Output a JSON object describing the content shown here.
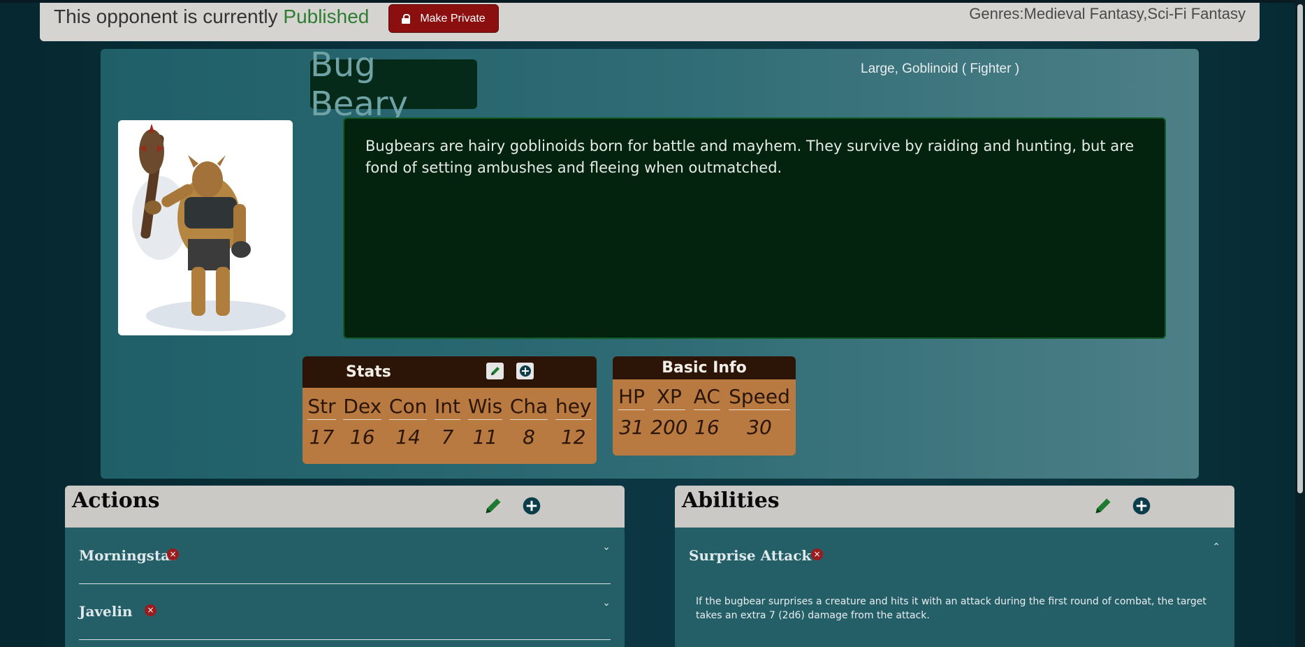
{
  "header": {
    "status_prefix": "This opponent is currently ",
    "status_value": "Published",
    "make_private_label": "Make Private",
    "genres": "Genres:Medieval Fantasy,Sci-Fi Fantasy"
  },
  "opponent": {
    "name": "Bug Beary",
    "size_type": "Large, Goblinoid ( Fighter )",
    "description": "Bugbears are hairy goblinoids born for battle and mayhem. They survive by raiding and hunting, but are fond of setting ambushes and fleeing when outmatched."
  },
  "stats": {
    "title": "Stats",
    "labels": [
      "Str",
      "Dex",
      "Con",
      "Int",
      "Wis",
      "Cha",
      "hey"
    ],
    "values": [
      "17",
      "16",
      "14",
      "7",
      "11",
      "8",
      "12"
    ]
  },
  "basic_info": {
    "title": "Basic Info",
    "labels": [
      "HP",
      "XP",
      "AC",
      "Speed"
    ],
    "values": [
      "31",
      "200",
      "16",
      "30"
    ]
  },
  "actions": {
    "title": "Actions",
    "items": [
      "Morningstar",
      "Javelin"
    ]
  },
  "abilities": {
    "title": "Abilities",
    "items": [
      {
        "name": "Surprise Attack",
        "text": "If the bugbear surprises a creature and hits it with an attack during the first round of combat, the target takes an extra 7 (2d6) damage from the attack."
      }
    ]
  },
  "colors": {
    "published": "#2e7d32",
    "danger": "#8b0f0f",
    "card_head": "#2c1507",
    "card_body": "#b87a40",
    "edit_green": "#1e7a2e",
    "add_teal": "#0b3d4a"
  },
  "icons": [
    "lock-icon",
    "pencil-icon",
    "plus-circle-icon",
    "close-circle-icon",
    "chevron-down-icon",
    "chevron-up-icon"
  ]
}
